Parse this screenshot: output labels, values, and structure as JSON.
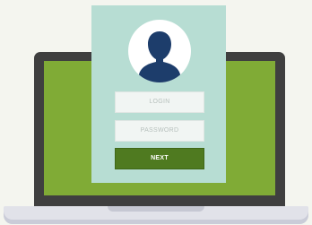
{
  "login_form": {
    "login_placeholder": "LOGIN",
    "password_placeholder": "PASSWORD",
    "next_label": "NEXT"
  },
  "icons": {
    "avatar": "user-silhouette-icon"
  },
  "colors": {
    "background": "#f4f5ef",
    "screen": "#80ab36",
    "card": "#b7ddd3",
    "avatar": "#1d3d6b",
    "button": "#4f7a20",
    "laptop_bezel": "#3f3f3f",
    "laptop_base": "#e1e2e9"
  }
}
